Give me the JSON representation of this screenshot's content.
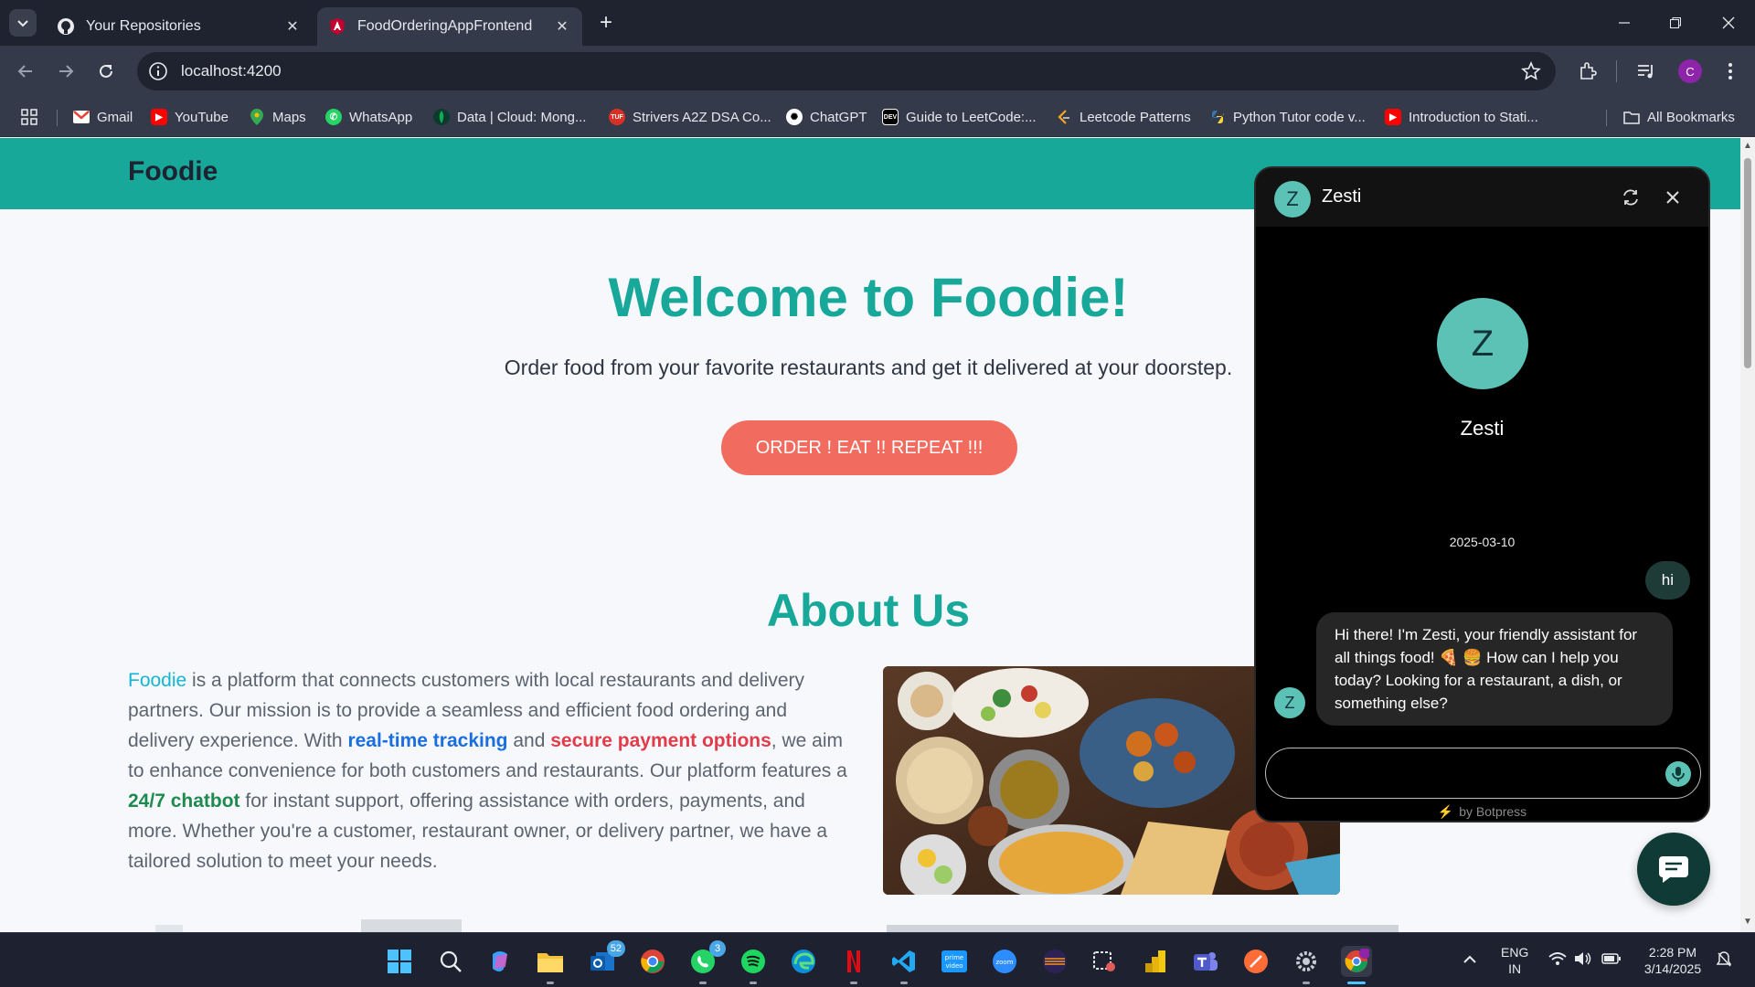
{
  "browser": {
    "tabs": [
      {
        "title": "Your Repositories",
        "icon": "github-icon"
      },
      {
        "title": "FoodOrderingAppFrontend",
        "icon": "angular-icon",
        "active": true
      }
    ],
    "url": "localhost:4200",
    "profile_initial": "C",
    "bookmarks": [
      {
        "label": "Gmail",
        "icon": "gmail-icon",
        "color": "#ea4335"
      },
      {
        "label": "YouTube",
        "icon": "youtube-icon",
        "color": "#ff0000"
      },
      {
        "label": "Maps",
        "icon": "maps-icon",
        "color": "#34a853"
      },
      {
        "label": "WhatsApp",
        "icon": "whatsapp-icon",
        "color": "#25d366"
      },
      {
        "label": "Data | Cloud: Mong...",
        "icon": "mongodb-icon",
        "color": "#13aa52"
      },
      {
        "label": "Strivers A2Z DSA Co...",
        "icon": "tuf-icon",
        "color": "#d93025"
      },
      {
        "label": "ChatGPT",
        "icon": "chatgpt-icon",
        "color": "#ffffff"
      },
      {
        "label": "Guide to LeetCode:...",
        "icon": "dev-icon",
        "color": "#000000"
      },
      {
        "label": "Leetcode Patterns",
        "icon": "leetcode-icon",
        "color": "#f5a623"
      },
      {
        "label": "Python Tutor code v...",
        "icon": "python-icon",
        "color": "#3776ab"
      },
      {
        "label": "Introduction to Stati...",
        "icon": "youtube-icon",
        "color": "#ff0000"
      }
    ],
    "all_bookmarks": "All Bookmarks"
  },
  "site": {
    "brand": "Foodie",
    "hero_title": "Welcome to Foodie!",
    "hero_subtitle": "Order food from your favorite restaurants and get it delivered at your doorstep.",
    "cta": "ORDER ! EAT !! REPEAT !!!",
    "about_title": "About Us",
    "about": {
      "brand_word": "Foodie",
      "p1": " is a platform that connects customers with local restaurants and delivery partners. Our mission is to provide a seamless and efficient food ordering and delivery experience. With ",
      "rt": "real-time tracking",
      "p2": " and ",
      "sp": "secure payment options",
      "p3": ", we aim to enhance convenience for both customers and restaurants. Our platform features a ",
      "cb": "24/7 chatbot",
      "p4": " for instant support, offering assistance with orders, payments, and more. Whether you're a customer, restaurant owner, or delivery partner, we have a tailored solution to meet your needs."
    },
    "accent": "#17a89a",
    "cta_color": "#f26b5f"
  },
  "chat": {
    "bot_name": "Zesti",
    "avatar_initial": "Z",
    "date": "2025-03-10",
    "user_message": "hi",
    "bot_message": "Hi there! I'm Zesti, your friendly assistant for all things food! 🍕 🍔 How can I help you today? Looking for a restaurant, a dish, or something else?",
    "input_value": "",
    "footer": "by Botpress"
  },
  "taskbar": {
    "apps": [
      {
        "name": "start-icon"
      },
      {
        "name": "search-icon"
      },
      {
        "name": "copilot-icon"
      },
      {
        "name": "file-explorer-icon"
      },
      {
        "name": "outlook-icon",
        "badge": "52"
      },
      {
        "name": "chrome-icon"
      },
      {
        "name": "whatsapp-icon",
        "badge": "3"
      },
      {
        "name": "spotify-icon"
      },
      {
        "name": "edge-icon"
      },
      {
        "name": "netflix-icon"
      },
      {
        "name": "vscode-icon"
      },
      {
        "name": "prime-video-icon"
      },
      {
        "name": "zoom-icon"
      },
      {
        "name": "eclipse-icon"
      },
      {
        "name": "snipping-tool-icon"
      },
      {
        "name": "power-bi-icon"
      },
      {
        "name": "teams-icon"
      },
      {
        "name": "postman-icon"
      },
      {
        "name": "settings-icon"
      },
      {
        "name": "chrome-profile-icon"
      }
    ],
    "language_top": "ENG",
    "language_bottom": "IN",
    "time": "2:28 PM",
    "date": "3/14/2025"
  }
}
